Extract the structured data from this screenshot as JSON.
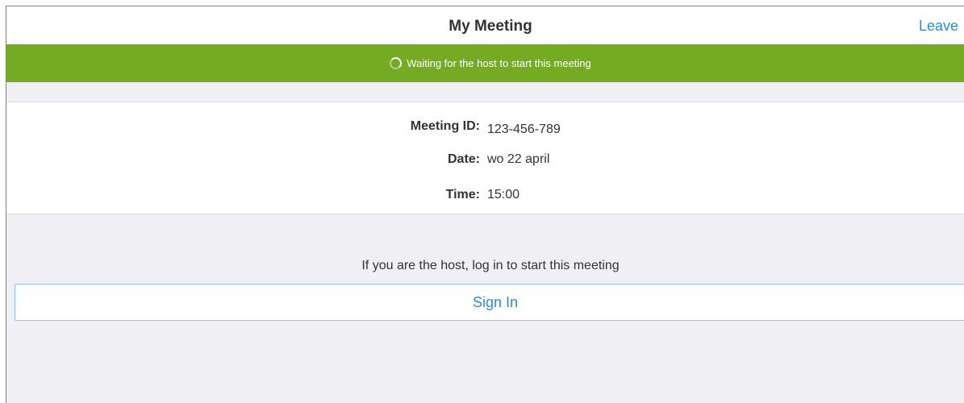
{
  "header": {
    "title": "My Meeting",
    "leave_label": "Leave"
  },
  "banner": {
    "message": "Waiting for the host to start this meeting",
    "icon": "spinner-icon"
  },
  "meeting": {
    "id_label": "Meeting ID:",
    "id_value": "123-456-789",
    "date_label": "Date:",
    "date_value": "wo 22 april",
    "time_label": "Time:",
    "time_value": "15:00"
  },
  "host": {
    "note": "If you are the host, log in to start this meeting",
    "signin_label": "Sign In"
  },
  "colors": {
    "banner_green": "#75ab22",
    "accent_blue": "#2d8cd8",
    "background_gray": "#efeff4"
  }
}
